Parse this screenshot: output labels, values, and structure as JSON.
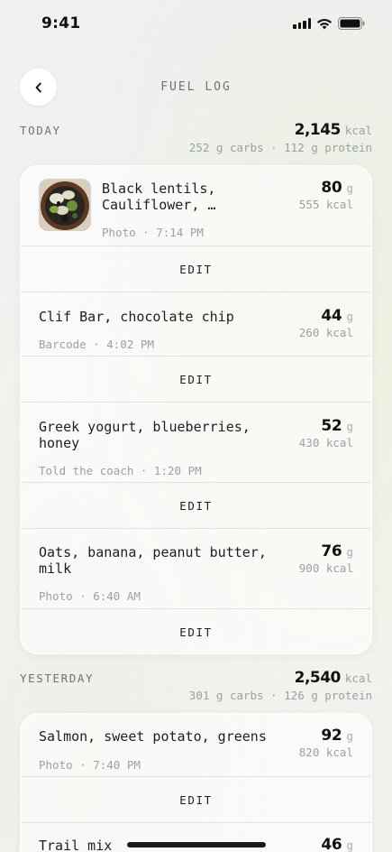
{
  "status": {
    "time": "9:41"
  },
  "header": {
    "title": "FUEL LOG",
    "back_icon": "chevron-left-icon"
  },
  "days": [
    {
      "label": "TODAY",
      "total_kcal": "2,145",
      "kcal_unit": "kcal",
      "macros": "252 g carbs · 112 g protein",
      "entries": [
        {
          "name": "Black lentils,\nCauliflower, …",
          "meta": "Photo · 7:14 PM",
          "grams": "80",
          "grams_unit": "g",
          "kcal": "555 kcal",
          "edit": "EDIT",
          "thumbnail": "food-photo-bowl"
        },
        {
          "name": "Clif Bar, chocolate chip",
          "meta": "Barcode · 4:02 PM",
          "grams": "44",
          "grams_unit": "g",
          "kcal": "260 kcal",
          "edit": "EDIT"
        },
        {
          "name": "Greek yogurt, blueberries,\nhoney",
          "meta": "Told the coach · 1:20 PM",
          "grams": "52",
          "grams_unit": "g",
          "kcal": "430 kcal",
          "edit": "EDIT"
        },
        {
          "name": "Oats, banana, peanut butter,\nmilk",
          "meta": "Photo · 6:40 AM",
          "grams": "76",
          "grams_unit": "g",
          "kcal": "900 kcal",
          "edit": "EDIT"
        }
      ]
    },
    {
      "label": "YESTERDAY",
      "total_kcal": "2,540",
      "kcal_unit": "kcal",
      "macros": "301 g carbs · 126 g protein",
      "entries": [
        {
          "name": "Salmon, sweet potato, greens",
          "meta": "Photo · 7:40 PM",
          "grams": "92",
          "grams_unit": "g",
          "kcal": "820 kcal",
          "edit": "EDIT"
        },
        {
          "name": "Trail mix",
          "grams": "46",
          "grams_unit": "g"
        }
      ]
    }
  ]
}
